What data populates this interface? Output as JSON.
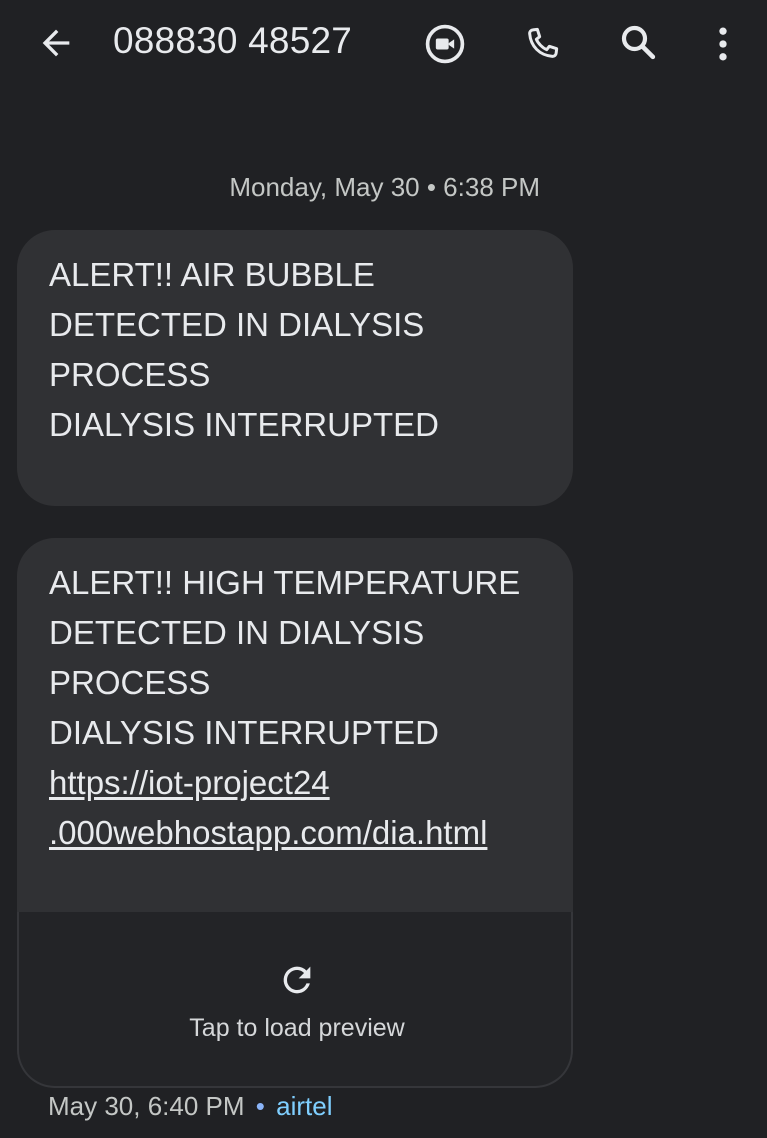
{
  "header": {
    "contact": "088830 48527",
    "icons": [
      "arrow-left-icon",
      "video-call-icon",
      "phone-icon",
      "search-icon",
      "more-vert-icon"
    ]
  },
  "conversation": {
    "date_divider": "Monday, May 30 • 6:38 PM",
    "messages": [
      {
        "lines": [
          "ALERT!! AIR BUBBLE",
          "DETECTED IN DIALYSIS",
          "PROCESS",
          "DIALYSIS INTERRUPTED"
        ]
      },
      {
        "lines": [
          "ALERT!! HIGH TEMPERATURE",
          "DETECTED IN DIALYSIS",
          "PROCESS",
          "DIALYSIS INTERRUPTED"
        ],
        "link_lines": [
          "https://iot-project24",
          ".000webhostapp.com/dia.html"
        ],
        "preview_label": "Tap to load preview",
        "preview_icon": "refresh-icon"
      }
    ],
    "footer": {
      "time": "May 30, 6:40 PM",
      "separator": "•",
      "carrier": "airtel"
    }
  },
  "colors": {
    "background": "#202124",
    "bubble": "#303134",
    "text": "#e8eaed",
    "carrier": "#7fcfff"
  }
}
